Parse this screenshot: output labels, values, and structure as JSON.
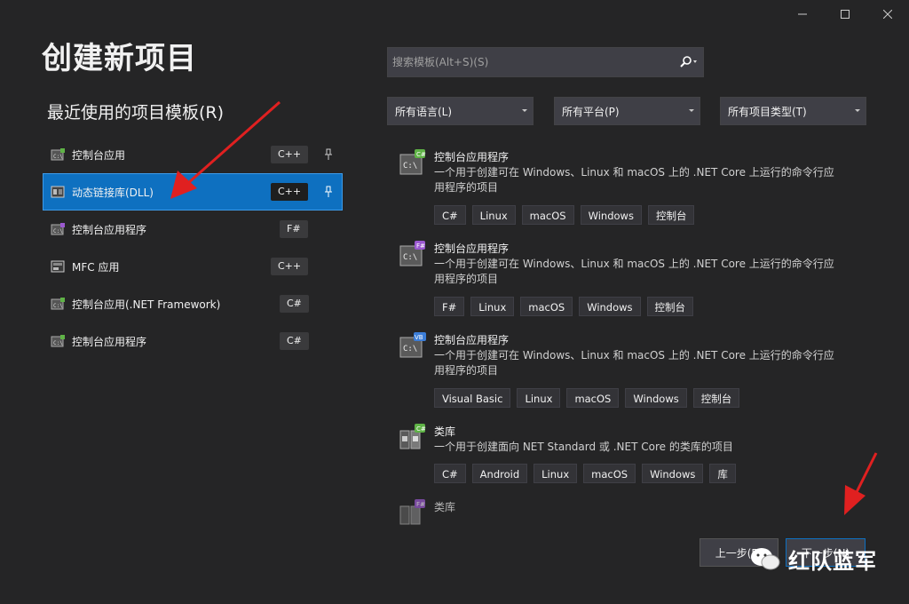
{
  "page_title": "创建新项目",
  "recent": {
    "title": "最近使用的项目模板(R)",
    "items": [
      {
        "label": "控制台应用",
        "lang": "C++"
      },
      {
        "label": "动态链接库(DLL)",
        "lang": "C++"
      },
      {
        "label": "控制台应用程序",
        "lang": "F#"
      },
      {
        "label": "MFC 应用",
        "lang": "C++"
      },
      {
        "label": "控制台应用(.NET Framework)",
        "lang": "C#"
      },
      {
        "label": "控制台应用程序",
        "lang": "C#"
      }
    ]
  },
  "search": {
    "placeholder": "搜索模板(Alt+S)(S)"
  },
  "filters": {
    "language": "所有语言(L)",
    "platform": "所有平台(P)",
    "project_type": "所有项目类型(T)"
  },
  "templates": [
    {
      "title": "控制台应用程序",
      "badge": "C#",
      "desc": "一个用于创建可在 Windows、Linux 和 macOS 上的 .NET Core 上运行的命令行应用程序的项目",
      "tags": [
        "C#",
        "Linux",
        "macOS",
        "Windows",
        "控制台"
      ]
    },
    {
      "title": "控制台应用程序",
      "badge": "F#",
      "desc": "一个用于创建可在 Windows、Linux 和 macOS 上的 .NET Core 上运行的命令行应用程序的项目",
      "tags": [
        "F#",
        "Linux",
        "macOS",
        "Windows",
        "控制台"
      ]
    },
    {
      "title": "控制台应用程序",
      "badge": "VB",
      "desc": "一个用于创建可在 Windows、Linux 和 macOS 上的 .NET Core 上运行的命令行应用程序的项目",
      "tags": [
        "Visual Basic",
        "Linux",
        "macOS",
        "Windows",
        "控制台"
      ]
    },
    {
      "title": "类库",
      "badge": "C#",
      "desc": "一个用于创建面向 NET Standard 或 .NET Core 的类库的项目",
      "tags": [
        "C#",
        "Android",
        "Linux",
        "macOS",
        "Windows",
        "库"
      ]
    },
    {
      "title": "类库",
      "badge": "F#",
      "desc": "",
      "tags": []
    }
  ],
  "buttons": {
    "back": "上一步(B)",
    "next": "下一步(N)"
  },
  "watermark": "红队蓝军",
  "colors": {
    "accent": "#0e70c0",
    "background": "#252526"
  }
}
